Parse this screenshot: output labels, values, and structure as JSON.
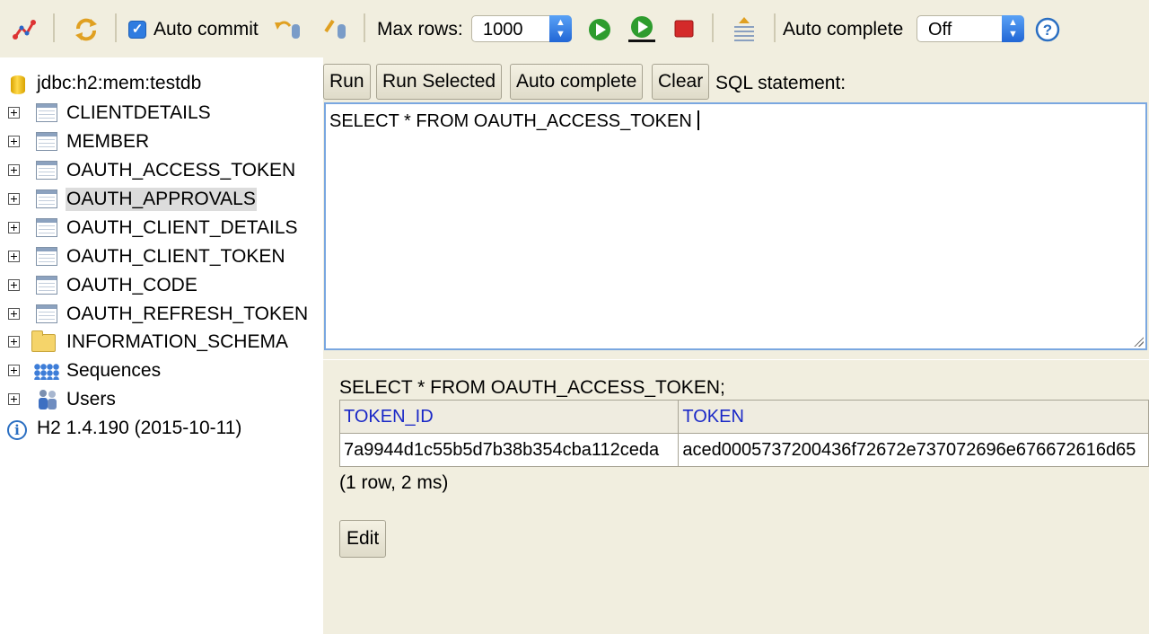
{
  "toolbar": {
    "auto_commit_label": "Auto commit",
    "auto_commit_checked": true,
    "max_rows_label": "Max rows:",
    "max_rows_value": "1000",
    "auto_complete_label": "Auto complete",
    "auto_complete_value": "Off",
    "help_glyph": "?"
  },
  "tree": {
    "connection": "jdbc:h2:mem:testdb",
    "tables": [
      "CLIENTDETAILS",
      "MEMBER",
      "OAUTH_ACCESS_TOKEN",
      "OAUTH_APPROVALS",
      "OAUTH_CLIENT_DETAILS",
      "OAUTH_CLIENT_TOKEN",
      "OAUTH_CODE",
      "OAUTH_REFRESH_TOKEN"
    ],
    "selected_table": "OAUTH_APPROVALS",
    "schema": "INFORMATION_SCHEMA",
    "sequences": "Sequences",
    "users": "Users",
    "version": "H2 1.4.190 (2015-10-11)"
  },
  "query": {
    "buttons": {
      "run": "Run",
      "run_selected": "Run Selected",
      "auto_complete": "Auto complete",
      "clear": "Clear"
    },
    "sql_label": "SQL statement:",
    "sql_text": "SELECT * FROM OAUTH_ACCESS_TOKEN "
  },
  "result": {
    "echo": "SELECT * FROM OAUTH_ACCESS_TOKEN;",
    "columns": [
      "TOKEN_ID",
      "TOKEN"
    ],
    "rows": [
      [
        "7a9944d1c55b5d7b38b354cba112ceda",
        "aced0005737200436f72672e737072696e676672616d65"
      ]
    ],
    "status": "(1 row, 2 ms)",
    "edit_label": "Edit"
  },
  "colors": {
    "toolbar_bg": "#f1eedf",
    "panel_bg": "#f1eedf",
    "header_link": "#1a28c7",
    "selection": "#dcdcdc",
    "sql_border": "#7aa7e0"
  },
  "icons": [
    "disconnect-icon",
    "refresh-icon",
    "rollback-icon",
    "commit-icon",
    "run-icon",
    "run-selected-icon",
    "stop-icon",
    "history-icon",
    "help-icon",
    "database-icon",
    "table-icon",
    "folder-icon",
    "sequence-icon",
    "users-icon",
    "info-icon"
  ]
}
